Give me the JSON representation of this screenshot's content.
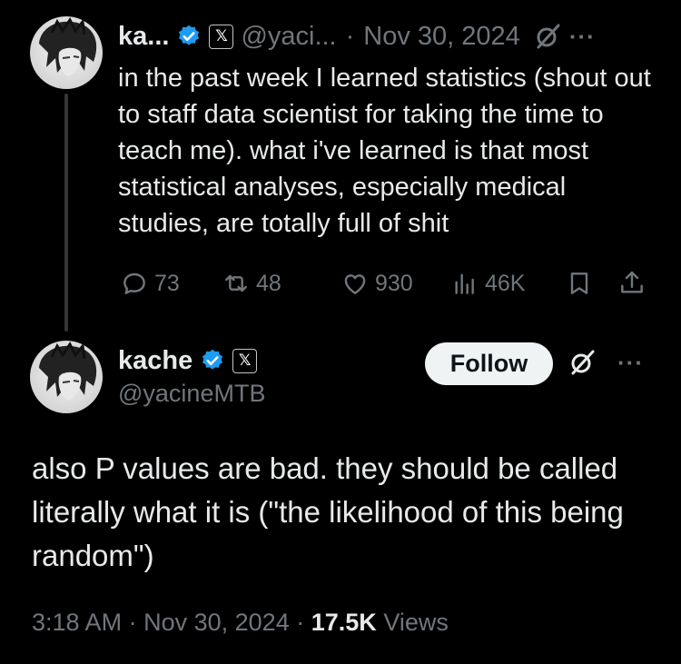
{
  "colors": {
    "background": "#000000",
    "text": "#e7e9ea",
    "muted": "#71767b",
    "verified_blue": "#1d9bf0",
    "follow_bg": "#eff3f4"
  },
  "tweet1": {
    "author_name": "ka...",
    "handle": "@yaci...",
    "separator": "·",
    "date": "Nov 30, 2024",
    "body": "in the past week I learned statistics (shout out to staff data scientist for taking the time to teach me). what i've learned is that most statistical analyses, especially medical studies, are totally full of shit",
    "icons": [
      "verified-badge-icon",
      "x-affiliate-badge-icon",
      "grok-icon",
      "more-icon"
    ],
    "actions": {
      "replies": "73",
      "reposts": "48",
      "likes": "930",
      "views": "46K"
    },
    "action_icons": [
      "reply-icon",
      "repost-icon",
      "like-icon",
      "views-icon",
      "bookmark-icon",
      "share-icon"
    ]
  },
  "tweet2": {
    "author_name": "kache",
    "handle": "@yacineMTB",
    "follow_label": "Follow",
    "body": "also P values are bad. they should be called literally what it is (\"the likelihood of this being random\")",
    "time": "3:18 AM",
    "separator": "·",
    "date": "Nov 30, 2024",
    "views_count": "17.5K",
    "views_label": "Views",
    "icons": [
      "verified-badge-icon",
      "x-affiliate-badge-icon",
      "grok-icon",
      "more-icon"
    ]
  },
  "x_badge_glyph": "𝕏"
}
